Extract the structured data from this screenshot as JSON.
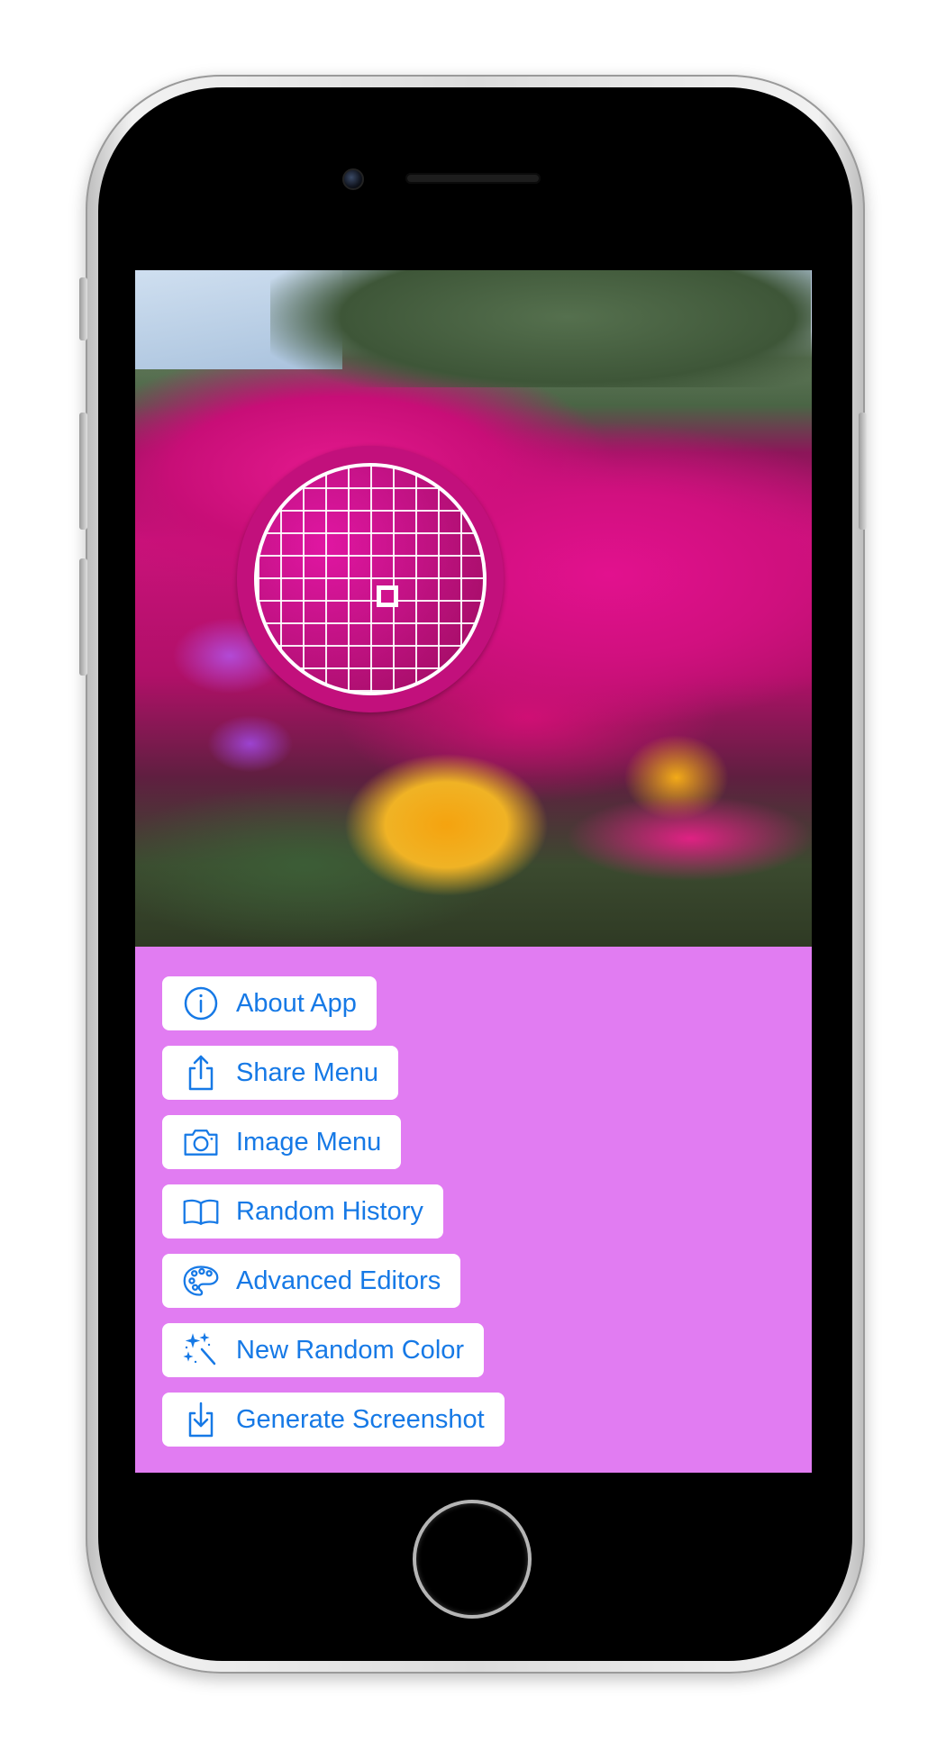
{
  "accent_color": "#1679e6",
  "panel_color": "#e17cf2",
  "loupe_color": "#c2107c",
  "menu": [
    {
      "label": "About App",
      "icon": "info-circle-icon"
    },
    {
      "label": "Share Menu",
      "icon": "share-icon"
    },
    {
      "label": "Image Menu",
      "icon": "camera-icon"
    },
    {
      "label": "Random History",
      "icon": "book-icon"
    },
    {
      "label": "Advanced Editors",
      "icon": "palette-icon"
    },
    {
      "label": "New Random Color",
      "icon": "magic-wand-icon"
    },
    {
      "label": "Generate Screenshot",
      "icon": "download-icon"
    }
  ]
}
